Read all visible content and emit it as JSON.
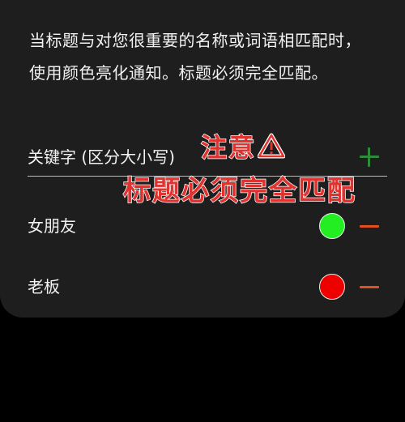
{
  "description": "当标题与对您很重要的名称或词语相匹配时，使用颜色亮化通知。标题必须完全匹配。",
  "keyword_input": {
    "placeholder": "关键字 (区分大小写)",
    "add_icon": "plus-icon",
    "add_color": "#2e8b3a"
  },
  "annotation": {
    "line1": "注意",
    "line1_icon": "warning-triangle-icon",
    "line2": "标题必须完全匹配",
    "color": "#e0322e"
  },
  "keywords": [
    {
      "name": "女朋友",
      "color": "#22ee22",
      "remove_icon": "minus-icon"
    },
    {
      "name": "老板",
      "color": "#ee0000",
      "remove_icon": "minus-icon"
    }
  ],
  "remove_color": "#e2501f"
}
